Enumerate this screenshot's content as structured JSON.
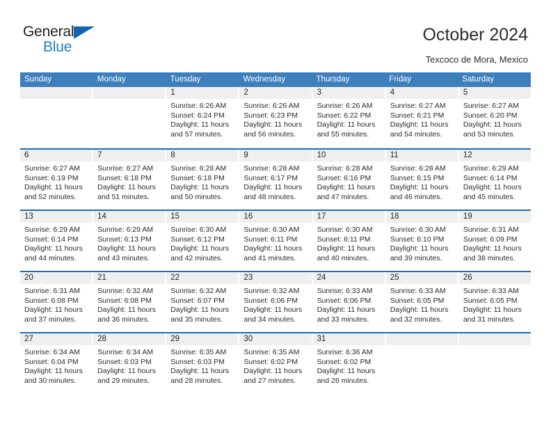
{
  "brand": {
    "logo_text_1": "General",
    "logo_text_2": "Blue",
    "triangle_icon": "blue-triangle-icon",
    "accent_blue": "#1f7ec4",
    "header_blue": "#3d7ebd",
    "row_divider_blue": "#1f6bad",
    "day_band_gray": "#efefef"
  },
  "header": {
    "title": "October 2024",
    "subtitle": "Texcoco de Mora, Mexico"
  },
  "weekdays": [
    "Sunday",
    "Monday",
    "Tuesday",
    "Wednesday",
    "Thursday",
    "Friday",
    "Saturday"
  ],
  "weeks": [
    [
      {
        "day": "",
        "sunrise": "",
        "sunset": "",
        "daylight_1": "",
        "daylight_2": ""
      },
      {
        "day": "",
        "sunrise": "",
        "sunset": "",
        "daylight_1": "",
        "daylight_2": ""
      },
      {
        "day": "1",
        "sunrise": "Sunrise: 6:26 AM",
        "sunset": "Sunset: 6:24 PM",
        "daylight_1": "Daylight: 11 hours",
        "daylight_2": "and 57 minutes."
      },
      {
        "day": "2",
        "sunrise": "Sunrise: 6:26 AM",
        "sunset": "Sunset: 6:23 PM",
        "daylight_1": "Daylight: 11 hours",
        "daylight_2": "and 56 minutes."
      },
      {
        "day": "3",
        "sunrise": "Sunrise: 6:26 AM",
        "sunset": "Sunset: 6:22 PM",
        "daylight_1": "Daylight: 11 hours",
        "daylight_2": "and 55 minutes."
      },
      {
        "day": "4",
        "sunrise": "Sunrise: 6:27 AM",
        "sunset": "Sunset: 6:21 PM",
        "daylight_1": "Daylight: 11 hours",
        "daylight_2": "and 54 minutes."
      },
      {
        "day": "5",
        "sunrise": "Sunrise: 6:27 AM",
        "sunset": "Sunset: 6:20 PM",
        "daylight_1": "Daylight: 11 hours",
        "daylight_2": "and 53 minutes."
      }
    ],
    [
      {
        "day": "6",
        "sunrise": "Sunrise: 6:27 AM",
        "sunset": "Sunset: 6:19 PM",
        "daylight_1": "Daylight: 11 hours",
        "daylight_2": "and 52 minutes."
      },
      {
        "day": "7",
        "sunrise": "Sunrise: 6:27 AM",
        "sunset": "Sunset: 6:18 PM",
        "daylight_1": "Daylight: 11 hours",
        "daylight_2": "and 51 minutes."
      },
      {
        "day": "8",
        "sunrise": "Sunrise: 6:28 AM",
        "sunset": "Sunset: 6:18 PM",
        "daylight_1": "Daylight: 11 hours",
        "daylight_2": "and 50 minutes."
      },
      {
        "day": "9",
        "sunrise": "Sunrise: 6:28 AM",
        "sunset": "Sunset: 6:17 PM",
        "daylight_1": "Daylight: 11 hours",
        "daylight_2": "and 48 minutes."
      },
      {
        "day": "10",
        "sunrise": "Sunrise: 6:28 AM",
        "sunset": "Sunset: 6:16 PM",
        "daylight_1": "Daylight: 11 hours",
        "daylight_2": "and 47 minutes."
      },
      {
        "day": "11",
        "sunrise": "Sunrise: 6:28 AM",
        "sunset": "Sunset: 6:15 PM",
        "daylight_1": "Daylight: 11 hours",
        "daylight_2": "and 46 minutes."
      },
      {
        "day": "12",
        "sunrise": "Sunrise: 6:29 AM",
        "sunset": "Sunset: 6:14 PM",
        "daylight_1": "Daylight: 11 hours",
        "daylight_2": "and 45 minutes."
      }
    ],
    [
      {
        "day": "13",
        "sunrise": "Sunrise: 6:29 AM",
        "sunset": "Sunset: 6:14 PM",
        "daylight_1": "Daylight: 11 hours",
        "daylight_2": "and 44 minutes."
      },
      {
        "day": "14",
        "sunrise": "Sunrise: 6:29 AM",
        "sunset": "Sunset: 6:13 PM",
        "daylight_1": "Daylight: 11 hours",
        "daylight_2": "and 43 minutes."
      },
      {
        "day": "15",
        "sunrise": "Sunrise: 6:30 AM",
        "sunset": "Sunset: 6:12 PM",
        "daylight_1": "Daylight: 11 hours",
        "daylight_2": "and 42 minutes."
      },
      {
        "day": "16",
        "sunrise": "Sunrise: 6:30 AM",
        "sunset": "Sunset: 6:11 PM",
        "daylight_1": "Daylight: 11 hours",
        "daylight_2": "and 41 minutes."
      },
      {
        "day": "17",
        "sunrise": "Sunrise: 6:30 AM",
        "sunset": "Sunset: 6:11 PM",
        "daylight_1": "Daylight: 11 hours",
        "daylight_2": "and 40 minutes."
      },
      {
        "day": "18",
        "sunrise": "Sunrise: 6:30 AM",
        "sunset": "Sunset: 6:10 PM",
        "daylight_1": "Daylight: 11 hours",
        "daylight_2": "and 39 minutes."
      },
      {
        "day": "19",
        "sunrise": "Sunrise: 6:31 AM",
        "sunset": "Sunset: 6:09 PM",
        "daylight_1": "Daylight: 11 hours",
        "daylight_2": "and 38 minutes."
      }
    ],
    [
      {
        "day": "20",
        "sunrise": "Sunrise: 6:31 AM",
        "sunset": "Sunset: 6:08 PM",
        "daylight_1": "Daylight: 11 hours",
        "daylight_2": "and 37 minutes."
      },
      {
        "day": "21",
        "sunrise": "Sunrise: 6:32 AM",
        "sunset": "Sunset: 6:08 PM",
        "daylight_1": "Daylight: 11 hours",
        "daylight_2": "and 36 minutes."
      },
      {
        "day": "22",
        "sunrise": "Sunrise: 6:32 AM",
        "sunset": "Sunset: 6:07 PM",
        "daylight_1": "Daylight: 11 hours",
        "daylight_2": "and 35 minutes."
      },
      {
        "day": "23",
        "sunrise": "Sunrise: 6:32 AM",
        "sunset": "Sunset: 6:06 PM",
        "daylight_1": "Daylight: 11 hours",
        "daylight_2": "and 34 minutes."
      },
      {
        "day": "24",
        "sunrise": "Sunrise: 6:33 AM",
        "sunset": "Sunset: 6:06 PM",
        "daylight_1": "Daylight: 11 hours",
        "daylight_2": "and 33 minutes."
      },
      {
        "day": "25",
        "sunrise": "Sunrise: 6:33 AM",
        "sunset": "Sunset: 6:05 PM",
        "daylight_1": "Daylight: 11 hours",
        "daylight_2": "and 32 minutes."
      },
      {
        "day": "26",
        "sunrise": "Sunrise: 6:33 AM",
        "sunset": "Sunset: 6:05 PM",
        "daylight_1": "Daylight: 11 hours",
        "daylight_2": "and 31 minutes."
      }
    ],
    [
      {
        "day": "27",
        "sunrise": "Sunrise: 6:34 AM",
        "sunset": "Sunset: 6:04 PM",
        "daylight_1": "Daylight: 11 hours",
        "daylight_2": "and 30 minutes."
      },
      {
        "day": "28",
        "sunrise": "Sunrise: 6:34 AM",
        "sunset": "Sunset: 6:03 PM",
        "daylight_1": "Daylight: 11 hours",
        "daylight_2": "and 29 minutes."
      },
      {
        "day": "29",
        "sunrise": "Sunrise: 6:35 AM",
        "sunset": "Sunset: 6:03 PM",
        "daylight_1": "Daylight: 11 hours",
        "daylight_2": "and 28 minutes."
      },
      {
        "day": "30",
        "sunrise": "Sunrise: 6:35 AM",
        "sunset": "Sunset: 6:02 PM",
        "daylight_1": "Daylight: 11 hours",
        "daylight_2": "and 27 minutes."
      },
      {
        "day": "31",
        "sunrise": "Sunrise: 6:36 AM",
        "sunset": "Sunset: 6:02 PM",
        "daylight_1": "Daylight: 11 hours",
        "daylight_2": "and 26 minutes."
      },
      {
        "day": "",
        "sunrise": "",
        "sunset": "",
        "daylight_1": "",
        "daylight_2": ""
      },
      {
        "day": "",
        "sunrise": "",
        "sunset": "",
        "daylight_1": "",
        "daylight_2": ""
      }
    ]
  ]
}
